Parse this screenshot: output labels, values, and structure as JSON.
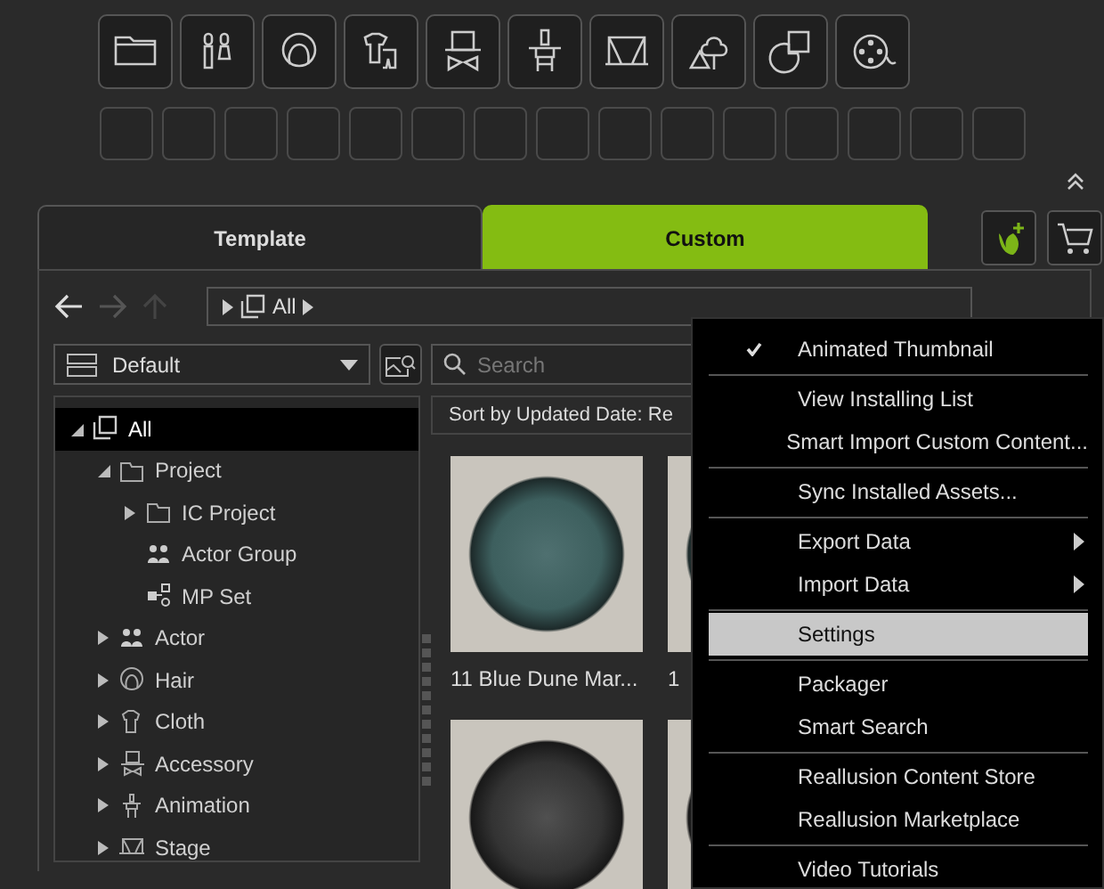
{
  "tabs": [
    {
      "label": "Template",
      "selected": false
    },
    {
      "label": "Custom",
      "selected": true
    }
  ],
  "breadcrumb": {
    "label": "All"
  },
  "filter_dropdown": {
    "value": "Default"
  },
  "search": {
    "placeholder": "Search"
  },
  "sort_bar": {
    "label": "Sort by Updated Date: Re"
  },
  "tree": [
    {
      "label": "All",
      "expanded": true,
      "selected": true,
      "children": [
        {
          "label": "Project",
          "expanded": true,
          "selected": false,
          "children": [
            {
              "label": "IC Project",
              "expanded": false,
              "selected": false
            },
            {
              "label": "Actor Group",
              "selected": false
            },
            {
              "label": "MP Set",
              "selected": false
            }
          ]
        },
        {
          "label": "Actor",
          "expanded": false,
          "selected": false
        },
        {
          "label": "Hair",
          "expanded": false,
          "selected": false
        },
        {
          "label": "Cloth",
          "expanded": false,
          "selected": false
        },
        {
          "label": "Accessory",
          "expanded": false,
          "selected": false
        },
        {
          "label": "Animation",
          "expanded": false,
          "selected": false
        },
        {
          "label": "Stage",
          "expanded": false,
          "selected": false
        }
      ]
    }
  ],
  "thumbnails": [
    {
      "caption": "11 Blue Dune Mar..."
    },
    {
      "caption": "1"
    }
  ],
  "context_menu": [
    [
      {
        "label": "Animated Thumbnail",
        "checked": true,
        "submenu": false,
        "selected": false
      }
    ],
    [
      {
        "label": "View Installing List",
        "checked": false,
        "submenu": false,
        "selected": false
      },
      {
        "label": "Smart Import Custom Content...",
        "checked": false,
        "submenu": false,
        "selected": false
      }
    ],
    [
      {
        "label": "Sync Installed Assets...",
        "checked": false,
        "submenu": false,
        "selected": false
      }
    ],
    [
      {
        "label": "Export Data",
        "checked": false,
        "submenu": true,
        "selected": false
      },
      {
        "label": "Import Data",
        "checked": false,
        "submenu": true,
        "selected": false
      }
    ],
    [
      {
        "label": "Settings",
        "checked": false,
        "submenu": false,
        "selected": true
      }
    ],
    [
      {
        "label": "Packager",
        "checked": false,
        "submenu": false,
        "selected": false
      },
      {
        "label": "Smart Search",
        "checked": false,
        "submenu": false,
        "selected": false
      }
    ],
    [
      {
        "label": "Reallusion Content Store",
        "checked": false,
        "submenu": false,
        "selected": false
      },
      {
        "label": "Reallusion Marketplace",
        "checked": false,
        "submenu": false,
        "selected": false
      }
    ],
    [
      {
        "label": "Video Tutorials",
        "checked": false,
        "submenu": false,
        "selected": false
      }
    ]
  ]
}
